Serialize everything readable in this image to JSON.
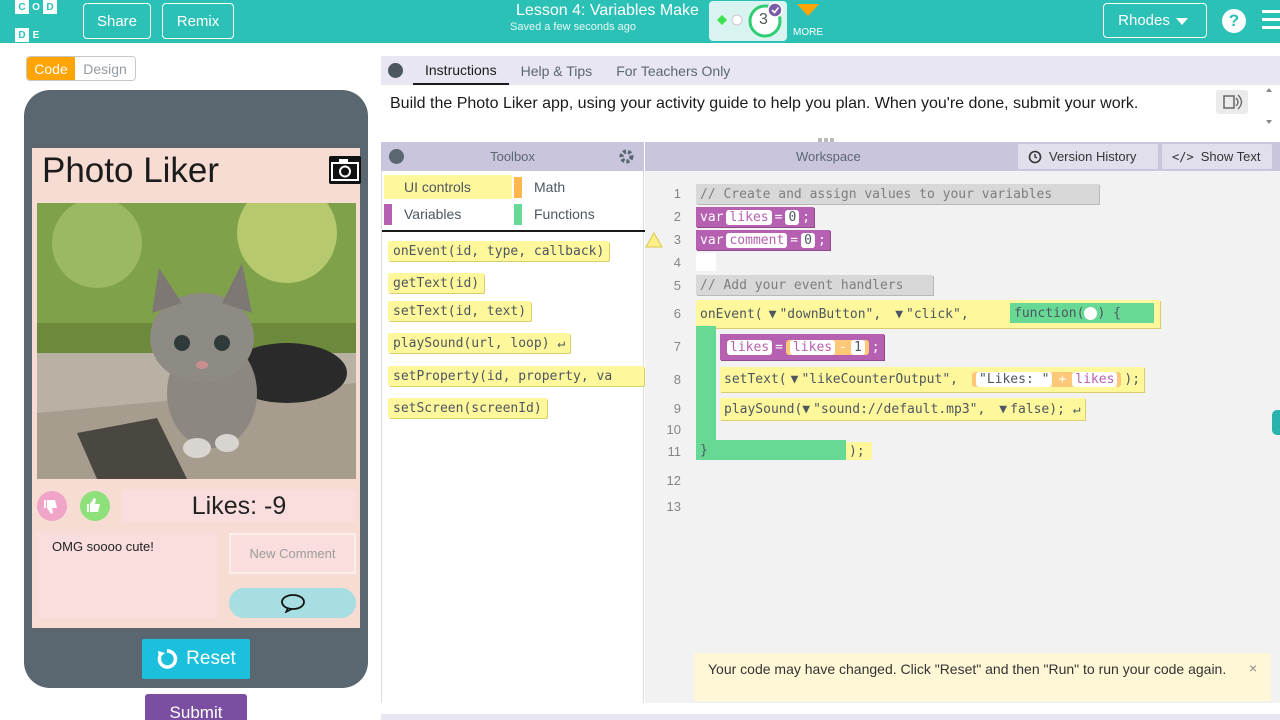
{
  "header": {
    "logo_letters": [
      "C",
      "O",
      "D",
      "E"
    ],
    "share_label": "Share",
    "remix_label": "Remix",
    "lesson_title": "Lesson 4: Variables Make",
    "saved_text": "Saved a few seconds ago",
    "level_number": "3",
    "more_label": "MORE",
    "user_label": "Rhodes",
    "help_label": "?"
  },
  "mode_toggle": {
    "code_label": "Code",
    "design_label": "Design"
  },
  "app": {
    "title": "Photo Liker",
    "likes_text": "Likes: -9",
    "comment_text": "OMG soooo cute!",
    "comment_placeholder": "New Comment",
    "reset_label": "Reset",
    "submit_label": "Submit"
  },
  "instructions": {
    "tabs": [
      "Instructions",
      "Help & Tips",
      "For Teachers Only"
    ],
    "active_tab": "Instructions",
    "text": "Build the Photo Liker app, using your activity guide to help you plan. When you're done, submit your work."
  },
  "toolbox": {
    "title": "Toolbox",
    "categories": [
      {
        "label": "UI controls",
        "color": "#fff176"
      },
      {
        "label": "Math",
        "color": "#ffb74d"
      },
      {
        "label": "Variables",
        "color": "#b660b1"
      },
      {
        "label": "Functions",
        "color": "#68d995"
      }
    ],
    "blocks": [
      "onEvent(id, type, callback)",
      "getText(id)",
      "setText(id, text)",
      "playSound(url, loop) ↵",
      "setProperty(id, property, va",
      "setScreen(screenId)"
    ]
  },
  "workspace": {
    "title": "Workspace",
    "version_history_label": "Version History",
    "show_text_label": "Show Text",
    "line_numbers": [
      "1",
      "2",
      "3",
      "4",
      "5",
      "6",
      "7",
      "8",
      "9",
      "10",
      "11",
      "12",
      "13"
    ],
    "code": {
      "comment1": "// Create and assign values to your variables",
      "var_kw": "var",
      "var1_name": "likes",
      "var2_name": "comment",
      "assign": "=",
      "zero": "0",
      "semicolon": ";",
      "comment2": "// Add your event handlers",
      "onevent_prefix": "onEvent(",
      "dropdown_arrow": "▼",
      "down_button_str": "\"downButton\",",
      "click_str": "\"click\",",
      "function_kw": "function(",
      "function_brace": ") {",
      "likes_var": "likes",
      "minus": "-",
      "one": "1",
      "settext_prefix": "setText(",
      "likecounter_str": "\"likeCounterOutput\",",
      "likes_str": "\"Likes: \"",
      "plus": "+",
      "close_semi": ");",
      "playsound_prefix": "playSound(",
      "sound_str": "\"sound://default.mp3\",",
      "false_kw": "false",
      "close_return": "); ↵",
      "close_brace": "}",
      "end_paren": ");"
    }
  },
  "notice": {
    "text": "Your code may have changed. Click \"Reset\" and then \"Run\" to run your code again.",
    "close_label": "×"
  }
}
